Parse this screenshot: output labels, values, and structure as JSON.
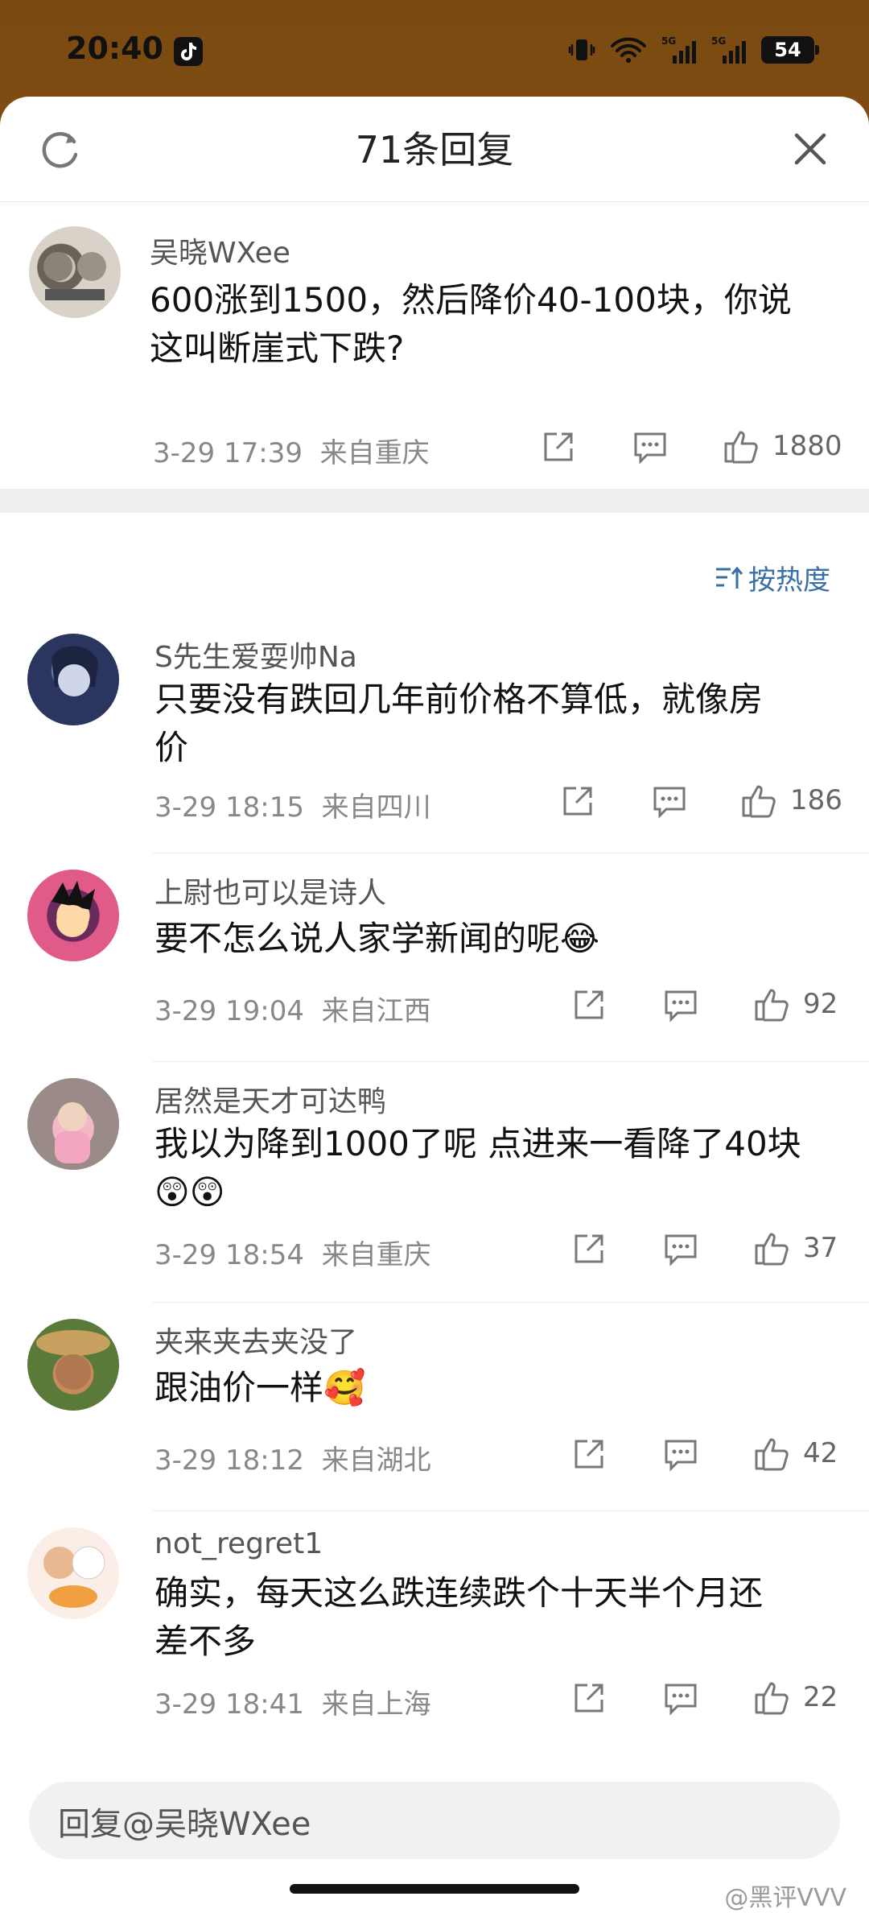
{
  "status": {
    "time": "20:40",
    "battery": "54"
  },
  "sheet": {
    "title": "71条回复",
    "sort_label": "按热度"
  },
  "main_comment": {
    "user": "吴晓WXee",
    "text_line1": "600涨到1500，然后降价40-100块，你说",
    "text_line2": "这叫断崖式下跌?",
    "date": "3-29 17:39",
    "location": "来自重庆",
    "likes": "1880"
  },
  "replies": [
    {
      "user": "S先生爱耍帅Na",
      "text_line1": "只要没有跌回几年前价格不算低，就像房",
      "text_line2": "价",
      "date": "3-29 18:15",
      "location": "来自四川",
      "likes": "186"
    },
    {
      "user": "上尉也可以是诗人",
      "text_line1": "要不怎么说人家学新闻的呢😂",
      "date": "3-29 19:04",
      "location": "来自江西",
      "likes": "92"
    },
    {
      "user": "居然是天才可达鸭",
      "text_line1": "我以为降到1000了呢 点进来一看降了40块",
      "text_line2": "😲😲",
      "date": "3-29 18:54",
      "location": "来自重庆",
      "likes": "37"
    },
    {
      "user": "夹来夹去夹没了",
      "text_line1": "跟油价一样🥰",
      "date": "3-29 18:12",
      "location": "来自湖北",
      "likes": "42"
    },
    {
      "user": "not_regret1",
      "text_line1": "确实，每天这么跌连续跌个十天半个月还",
      "text_line2": "差不多",
      "date": "3-29 18:41",
      "location": "来自上海",
      "likes": "22"
    }
  ],
  "input": {
    "placeholder": "回复@吴晓WXee"
  },
  "watermark": "@黑评VVV"
}
